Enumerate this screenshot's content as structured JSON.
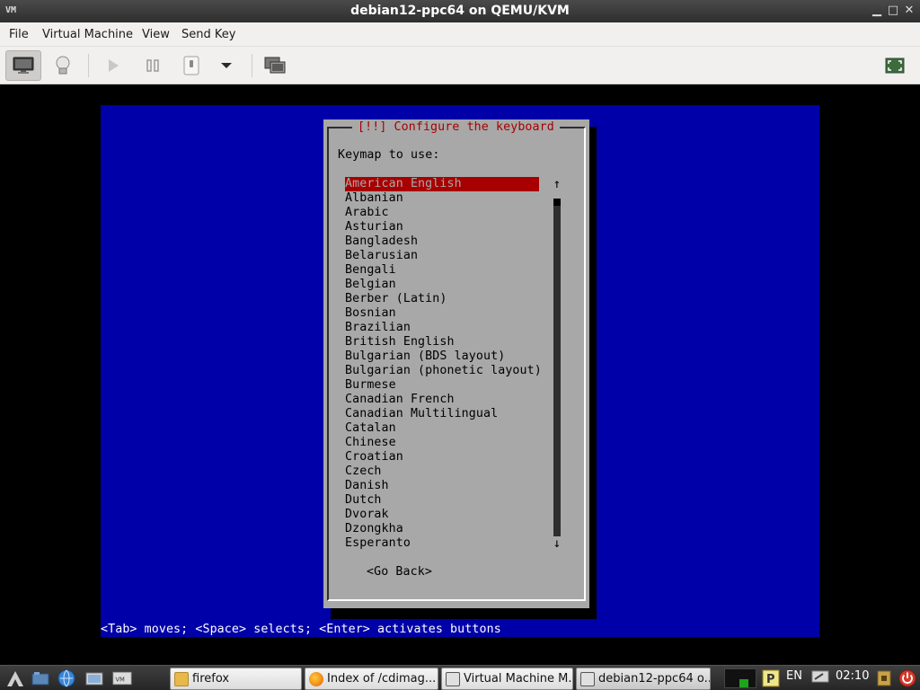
{
  "window": {
    "title": "debian12-ppc64 on QEMU/KVM",
    "wm_icon": "VM",
    "minimize": "▁",
    "maximize": "□",
    "close": "✕"
  },
  "menubar": {
    "items": [
      "File",
      "Virtual Machine",
      "View",
      "Send Key"
    ]
  },
  "toolbar": {
    "buttons": [
      {
        "icon": "monitor-icon",
        "active": true
      },
      {
        "icon": "lightbulb-icon",
        "active": false
      },
      {
        "icon": "play-icon",
        "active": false
      },
      {
        "icon": "pause-icon",
        "active": false
      },
      {
        "icon": "power-icon",
        "active": false
      },
      {
        "icon": "dropdown-arrow-icon",
        "active": false
      },
      {
        "icon": "screenshot-icon",
        "active": false
      },
      {
        "icon": "fullscreen-icon",
        "active": false
      }
    ]
  },
  "installer": {
    "dialog_title": "[!!] Configure the keyboard",
    "prompt": "Keymap to use:",
    "keymaps": [
      "American English",
      "Albanian",
      "Arabic",
      "Asturian",
      "Bangladesh",
      "Belarusian",
      "Bengali",
      "Belgian",
      "Berber (Latin)",
      "Bosnian",
      "Brazilian",
      "British English",
      "Bulgarian (BDS layout)",
      "Bulgarian (phonetic layout)",
      "Burmese",
      "Canadian French",
      "Canadian Multilingual",
      "Catalan",
      "Chinese",
      "Croatian",
      "Czech",
      "Danish",
      "Dutch",
      "Dvorak",
      "Dzongkha",
      "Esperanto"
    ],
    "selected_index": 0,
    "scroll_up": "↑",
    "scroll_down": "↓",
    "go_back": "<Go Back>",
    "help_line": "<Tab> moves; <Space> selects; <Enter> activates buttons"
  },
  "taskbar": {
    "tasks": [
      {
        "label": "firefox",
        "icon": "folder-icon",
        "color": "#e8b84a"
      },
      {
        "label": "Index of /cdimag...",
        "icon": "firefox-icon",
        "color": "#e66000"
      },
      {
        "label": "Virtual Machine M...",
        "icon": "virt-manager-icon",
        "color": "#555555"
      },
      {
        "label": "debian12-ppc64 o...",
        "icon": "virt-manager-icon",
        "color": "#555555"
      }
    ],
    "keyboard_layout": "EN",
    "clock": "02:10"
  }
}
